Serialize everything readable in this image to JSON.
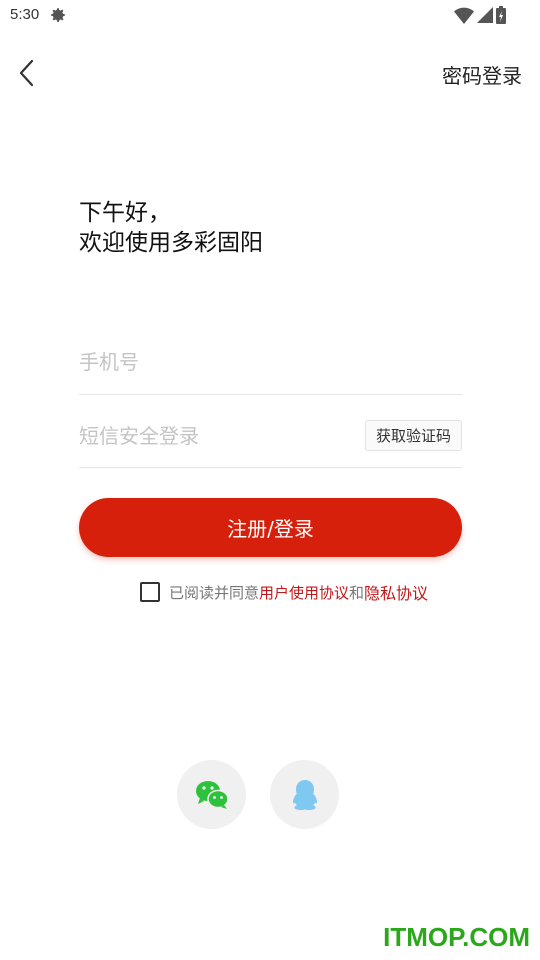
{
  "status_bar": {
    "time": "5:30"
  },
  "header": {
    "password_login": "密码登录"
  },
  "greeting": {
    "line1": "下午好，",
    "line2": "欢迎使用多彩固阳"
  },
  "form": {
    "phone_placeholder": "手机号",
    "sms_placeholder": "短信安全登录",
    "get_code_label": "获取验证码",
    "submit_label": "注册/登录"
  },
  "agreement": {
    "prefix": "已阅读并同意",
    "user_agreement": "用户使用协议",
    "and": "和",
    "privacy": "隐私协议"
  },
  "social": {
    "wechat": "wechat-icon",
    "qq": "qq-icon"
  },
  "watermark": "ITMOP.COM",
  "colors": {
    "primary": "#d6200b",
    "link": "#c2171a",
    "wechat": "#2dc13c",
    "qq": "#7fc8f0",
    "watermark": "#2aa71a"
  }
}
